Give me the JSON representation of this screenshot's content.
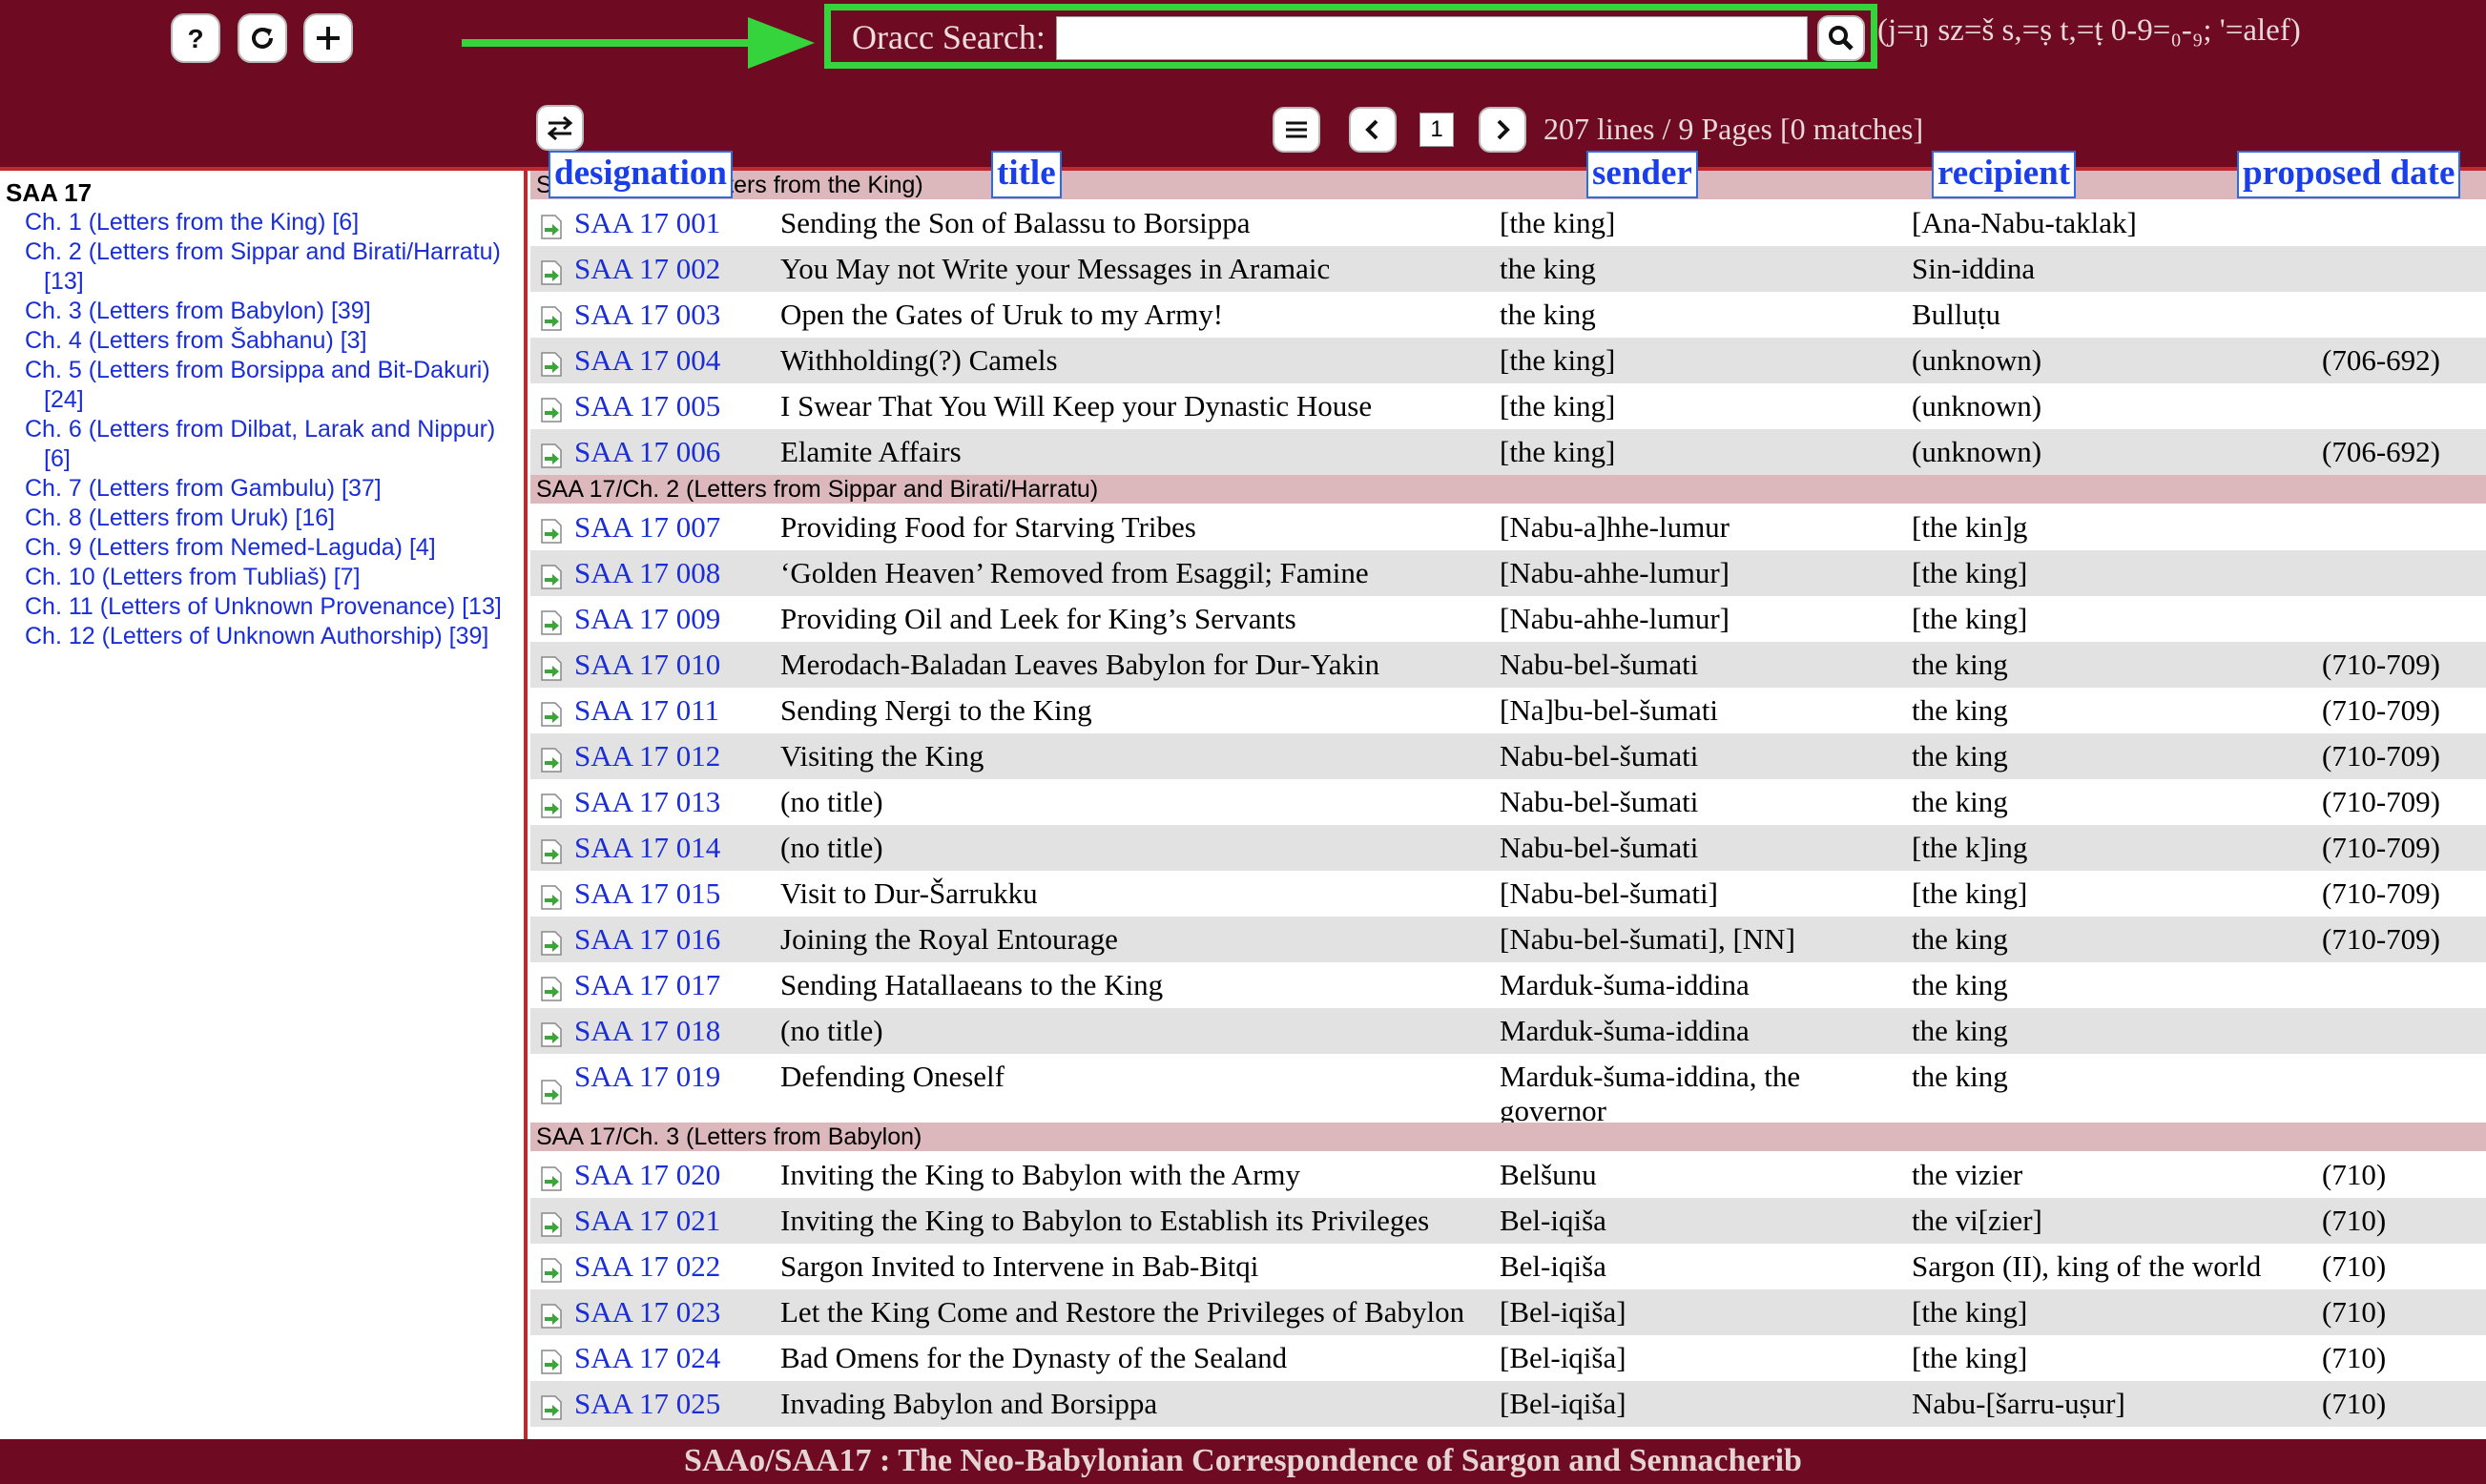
{
  "search": {
    "label": "Oracc Search:",
    "value": "",
    "hint": "(j=ŋ sz=š s,=ṣ t,=ṭ 0-9=₀-₉; '=alef)"
  },
  "pager": {
    "current_page": "1",
    "status": "207 lines / 9 Pages [0 matches]"
  },
  "sidebar": {
    "title": "SAA 17",
    "items": [
      {
        "label": "Ch. 1 (Letters from the King) [6]",
        "cont": ""
      },
      {
        "label": "Ch. 2 (Letters from Sippar and Birati/Harratu)",
        "cont": "[13]"
      },
      {
        "label": "Ch. 3 (Letters from Babylon) [39]",
        "cont": ""
      },
      {
        "label": "Ch. 4 (Letters from Šabhanu) [3]",
        "cont": ""
      },
      {
        "label": "Ch. 5 (Letters from Borsippa and Bit-Dakuri)",
        "cont": "[24]"
      },
      {
        "label": "Ch. 6 (Letters from Dilbat, Larak and Nippur)",
        "cont": "[6]"
      },
      {
        "label": "Ch. 7 (Letters from Gambulu) [37]",
        "cont": ""
      },
      {
        "label": "Ch. 8 (Letters from Uruk) [16]",
        "cont": ""
      },
      {
        "label": "Ch. 9 (Letters from Nemed-Laguda) [4]",
        "cont": ""
      },
      {
        "label": "Ch. 10 (Letters from Tubliaš) [7]",
        "cont": ""
      },
      {
        "label": "Ch. 11 (Letters of Unknown Provenance) [13]",
        "cont": ""
      },
      {
        "label": "Ch. 12 (Letters of Unknown Authorship) [39]",
        "cont": ""
      }
    ]
  },
  "columns": {
    "designation": "designation",
    "title": "title",
    "sender": "sender",
    "recipient": "recipient",
    "proposed_date": "proposed date"
  },
  "sections": [
    {
      "header": "SAA 17/Ch. 1 (Letters from the King)",
      "rows": [
        {
          "designation": "SAA 17 001",
          "title": "Sending the Son of Balassu to Borsippa",
          "sender": "[the king]",
          "recipient": "[Ana-Nabu-taklak]",
          "date": ""
        },
        {
          "designation": "SAA 17 002",
          "title": "You May not Write your Messages in Aramaic",
          "sender": "the king",
          "recipient": "Sin-iddina",
          "date": ""
        },
        {
          "designation": "SAA 17 003",
          "title": "Open the Gates of Uruk to my Army!",
          "sender": "the king",
          "recipient": "Bulluṭu",
          "date": ""
        },
        {
          "designation": "SAA 17 004",
          "title": "Withholding(?) Camels",
          "sender": "[the king]",
          "recipient": "(unknown)",
          "date": "(706-692)"
        },
        {
          "designation": "SAA 17 005",
          "title": "I Swear That You Will Keep your Dynastic House",
          "sender": "[the king]",
          "recipient": "(unknown)",
          "date": ""
        },
        {
          "designation": "SAA 17 006",
          "title": "Elamite Affairs",
          "sender": "[the king]",
          "recipient": "(unknown)",
          "date": "(706-692)"
        }
      ]
    },
    {
      "header": "SAA 17/Ch. 2 (Letters from Sippar and Birati/Harratu)",
      "rows": [
        {
          "designation": "SAA 17 007",
          "title": "Providing Food for Starving Tribes",
          "sender": "[Nabu-a]hhe-lumur",
          "recipient": "[the kin]g",
          "date": ""
        },
        {
          "designation": "SAA 17 008",
          "title": "‘Golden Heaven’ Removed from Esaggil; Famine",
          "sender": "[Nabu-ahhe-lumur]",
          "recipient": "[the king]",
          "date": ""
        },
        {
          "designation": "SAA 17 009",
          "title": "Providing Oil and Leek for King’s Servants",
          "sender": "[Nabu-ahhe-lumur]",
          "recipient": "[the king]",
          "date": ""
        },
        {
          "designation": "SAA 17 010",
          "title": "Merodach-Baladan Leaves Babylon for Dur-Yakin",
          "sender": "Nabu-bel-šumati",
          "recipient": "the king",
          "date": "(710-709)"
        },
        {
          "designation": "SAA 17 011",
          "title": "Sending Nergi to the King",
          "sender": "[Na]bu-bel-šumati",
          "recipient": "the king",
          "date": "(710-709)"
        },
        {
          "designation": "SAA 17 012",
          "title": "Visiting the King",
          "sender": "Nabu-bel-šumati",
          "recipient": "the king",
          "date": "(710-709)"
        },
        {
          "designation": "SAA 17 013",
          "title": "(no title)",
          "sender": "Nabu-bel-šumati",
          "recipient": "the king",
          "date": "(710-709)"
        },
        {
          "designation": "SAA 17 014",
          "title": "(no title)",
          "sender": "Nabu-bel-šumati",
          "recipient": "[the k]ing",
          "date": "(710-709)"
        },
        {
          "designation": "SAA 17 015",
          "title": "Visit to Dur-Šarrukku",
          "sender": "[Nabu-bel-šumati]",
          "recipient": "[the king]",
          "date": "(710-709)"
        },
        {
          "designation": "SAA 17 016",
          "title": "Joining the Royal Entourage",
          "sender": "[Nabu-bel-šumati], [NN]",
          "recipient": "the king",
          "date": "(710-709)"
        },
        {
          "designation": "SAA 17 017",
          "title": "Sending Hatallaeans to the King",
          "sender": "Marduk-šuma-iddina",
          "recipient": "the king",
          "date": ""
        },
        {
          "designation": "SAA 17 018",
          "title": "(no title)",
          "sender": "Marduk-šuma-iddina",
          "recipient": "the king",
          "date": ""
        },
        {
          "designation": "SAA 17 019",
          "title": "Defending Oneself",
          "sender": "Marduk-šuma-iddina, the",
          "sender2": "governor",
          "recipient": "the king",
          "date": ""
        }
      ]
    },
    {
      "header": "SAA 17/Ch. 3 (Letters from Babylon)",
      "rows": [
        {
          "designation": "SAA 17 020",
          "title": "Inviting the King to Babylon with the Army",
          "sender": "Belšunu",
          "recipient": "the vizier",
          "date": "(710)"
        },
        {
          "designation": "SAA 17 021",
          "title": "Inviting the King to Babylon to Establish its Privileges",
          "sender": "Bel-iqiša",
          "recipient": "the vi[zier]",
          "date": "(710)"
        },
        {
          "designation": "SAA 17 022",
          "title": "Sargon Invited to Intervene in Bab-Bitqi",
          "sender": "Bel-iqiša",
          "recipient": "Sargon (II), king of the world",
          "date": "(710)"
        },
        {
          "designation": "SAA 17 023",
          "title": "Let the King Come and Restore the Privileges of Babylon",
          "sender": "[Bel-iqiša]",
          "recipient": "[the king]",
          "date": "(710)"
        },
        {
          "designation": "SAA 17 024",
          "title": "Bad Omens for the Dynasty of the Sealand",
          "sender": "[Bel-iqiša]",
          "recipient": "[the king]",
          "date": "(710)"
        },
        {
          "designation": "SAA 17 025",
          "title": "Invading Babylon and Borsippa",
          "sender": "[Bel-iqiša]",
          "recipient": "Nabu-[šarru-uṣur]",
          "date": "(710)"
        }
      ]
    }
  ],
  "footer": {
    "text": "SAAo/SAA17 : The Neo-Babylonian Correspondence of Sargon and Sennacherib"
  },
  "colors": {
    "header_bg": "#6e0b23",
    "accent_red": "#c1272d",
    "link_blue": "#1a2ed8",
    "highlight_green": "#36d43c",
    "section_bg": "#dcb8bc",
    "row_alt": "#e2e2e2"
  },
  "icons": [
    "help-icon",
    "reset-icon",
    "plus-icon",
    "search-icon",
    "swap-icon",
    "menu-icon",
    "chevron-left-icon",
    "chevron-right-icon",
    "document-arrow-icon"
  ]
}
